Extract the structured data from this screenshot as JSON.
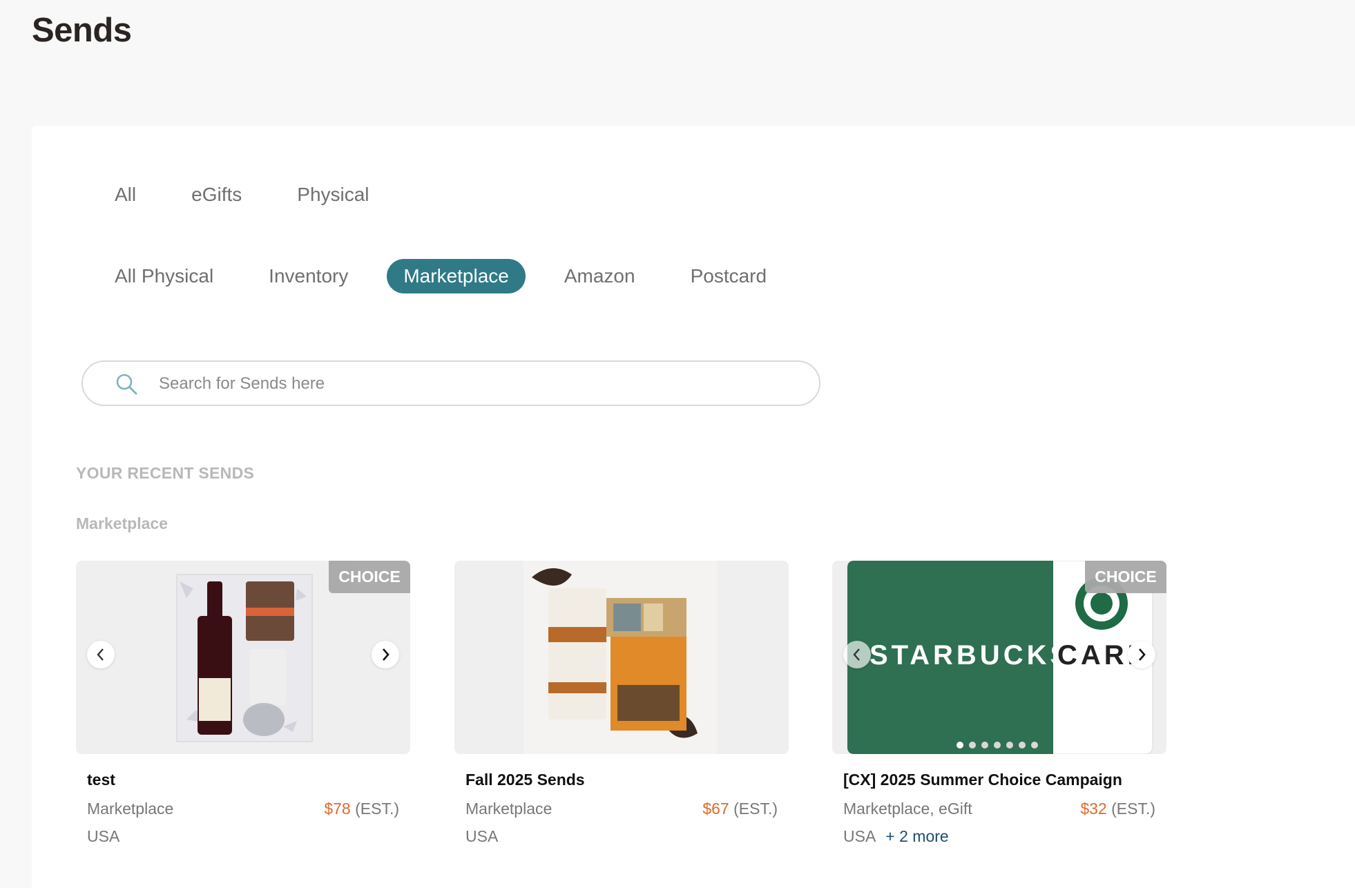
{
  "page": {
    "title": "Sends"
  },
  "primary_tabs": [
    {
      "label": "All",
      "active": false
    },
    {
      "label": "eGifts",
      "active": false
    },
    {
      "label": "Physical",
      "active": false
    }
  ],
  "secondary_tabs": [
    {
      "label": "All Physical",
      "active": false
    },
    {
      "label": "Inventory",
      "active": false
    },
    {
      "label": "Marketplace",
      "active": true
    },
    {
      "label": "Amazon",
      "active": false
    },
    {
      "label": "Postcard",
      "active": false
    }
  ],
  "search": {
    "placeholder": "Search for Sends here",
    "value": ""
  },
  "recent": {
    "section_title": "YOUR RECENT SENDS",
    "subsection_title": "Marketplace",
    "cards": [
      {
        "name": "test",
        "type": "Marketplace",
        "price": "$78",
        "price_suffix": "(EST.)",
        "country": "USA",
        "more": "",
        "badge": "CHOICE",
        "image": "wine-gift-box-image"
      },
      {
        "name": "Fall 2025 Sends",
        "type": "Marketplace",
        "price": "$67",
        "price_suffix": "(EST.)",
        "country": "USA",
        "more": "",
        "badge": "",
        "image": "fall-gift-box-image"
      },
      {
        "name": "[CX] 2025 Summer Choice Campaign",
        "type": "Marketplace, eGift",
        "price": "$32",
        "price_suffix": "(EST.)",
        "country": "USA",
        "more": "+ 2 more",
        "badge": "CHOICE",
        "image": "starbucks-card-image",
        "image_text": "STARBUCKS CARD"
      }
    ]
  },
  "colors": {
    "accent": "#2f7a86",
    "price": "#e06a2c",
    "link": "#1d4f6b",
    "starbucks_green": "#2f6f52"
  }
}
